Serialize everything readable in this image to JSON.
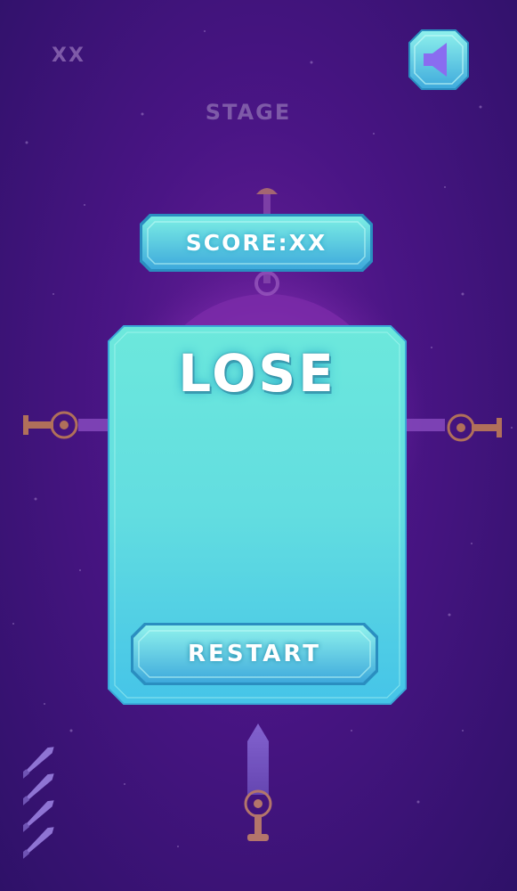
{
  "hud": {
    "level_counter": "XX",
    "stage_label": "STAGE",
    "sound": {
      "icon": "speaker-icon",
      "state": "on"
    }
  },
  "score": {
    "label": "SCORE:XX"
  },
  "result": {
    "title": "LOSE"
  },
  "actions": {
    "restart_label": "RESTART"
  },
  "knives_remaining": {
    "icon": "knife-icon",
    "count": 4
  },
  "colors": {
    "background_top": "#4a1585",
    "background_bottom": "#2e1168",
    "panel_top": "#6ce8dc",
    "panel_bottom": "#45c4e8",
    "button_light": "#8ff2ec",
    "button_dark": "#3ea9dc",
    "icon_purple": "#8a6cf0",
    "hud_text": "#7e5aa8"
  }
}
